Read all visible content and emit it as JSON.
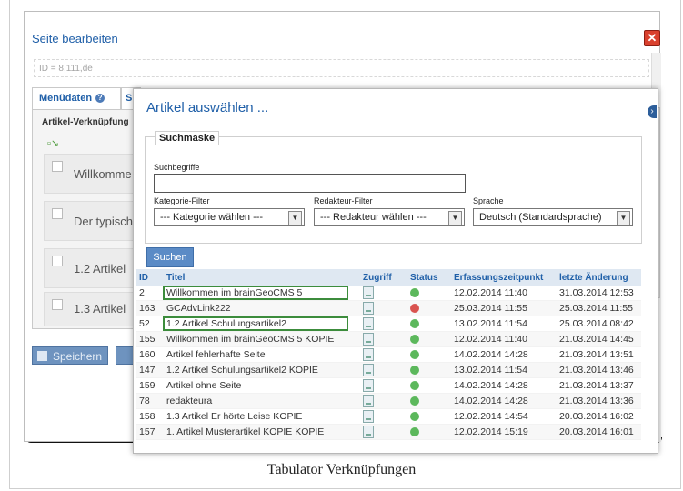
{
  "background_window": {
    "title": "Seite bearbeiten",
    "id_line": "ID = 8,111,de",
    "tab_menudaten": "Menüdaten",
    "tab_second": "S",
    "panel_label": "Artikel-Verknüpfung",
    "items": [
      "Willkomme",
      "Der typisch",
      "1.2 Artikel",
      "1.3 Artikel"
    ],
    "save_button": "Speichern"
  },
  "modal": {
    "title": "Artikel auswählen ...",
    "fieldset_legend": "Suchmaske",
    "search_label": "Suchbegriffe",
    "search_value": "",
    "kategorie_label": "Kategorie-Filter",
    "kategorie_value": "--- Kategorie wählen ---",
    "redakteur_label": "Redakteur-Filter",
    "redakteur_value": "--- Redakteur wählen ---",
    "sprache_label": "Sprache",
    "sprache_value": "Deutsch (Standardsprache)",
    "search_button": "Suchen",
    "columns": [
      "ID",
      "Titel",
      "Zugriff",
      "Status",
      "Erfassungszeitpunkt",
      "letzte Änderung"
    ],
    "rows": [
      {
        "id": "2",
        "title": "Willkommen im brainGeoCMS 5",
        "status": "green",
        "created": "12.02.2014 11:40",
        "changed": "31.03.2014 12:53",
        "highlight": true
      },
      {
        "id": "163",
        "title": "GCAdvLink222",
        "status": "red",
        "created": "25.03.2014 11:55",
        "changed": "25.03.2014 11:55",
        "highlight": false
      },
      {
        "id": "52",
        "title": "1.2 Artikel Schulungsartikel2",
        "status": "green",
        "created": "13.02.2014 11:54",
        "changed": "25.03.2014 08:42",
        "highlight": true
      },
      {
        "id": "155",
        "title": "Willkommen im brainGeoCMS 5 KOPIE",
        "status": "green",
        "created": "12.02.2014 11:40",
        "changed": "21.03.2014 14:45",
        "highlight": false
      },
      {
        "id": "160",
        "title": "Artikel fehlerhafte Seite",
        "status": "green",
        "created": "14.02.2014 14:28",
        "changed": "21.03.2014 13:51",
        "highlight": false
      },
      {
        "id": "147",
        "title": "1.2 Artikel Schulungsartikel2 KOPIE",
        "status": "green",
        "created": "13.02.2014 11:54",
        "changed": "21.03.2014 13:46",
        "highlight": false
      },
      {
        "id": "159",
        "title": "Artikel ohne Seite",
        "status": "green",
        "created": "14.02.2014 14:28",
        "changed": "21.03.2014 13:37",
        "highlight": false
      },
      {
        "id": "78",
        "title": "redakteura",
        "status": "green",
        "created": "14.02.2014 14:28",
        "changed": "21.03.2014 13:36",
        "highlight": false
      },
      {
        "id": "158",
        "title": "1.3 Artikel Er hörte Leise KOPIE",
        "status": "green",
        "created": "12.02.2014 14:54",
        "changed": "20.03.2014 16:02",
        "highlight": false
      },
      {
        "id": "157",
        "title": "1. Artikel Musterartikel KOPIE KOPIE",
        "status": "green",
        "created": "12.02.2014 15:19",
        "changed": "20.03.2014 16:01",
        "highlight": false
      }
    ]
  },
  "caption": "Tabulator Verknüpfungen",
  "colors": {
    "accent": "#1f5fa8",
    "status_green": "#5cb85c",
    "status_red": "#d9534f",
    "highlight": "#3c8c3c"
  }
}
